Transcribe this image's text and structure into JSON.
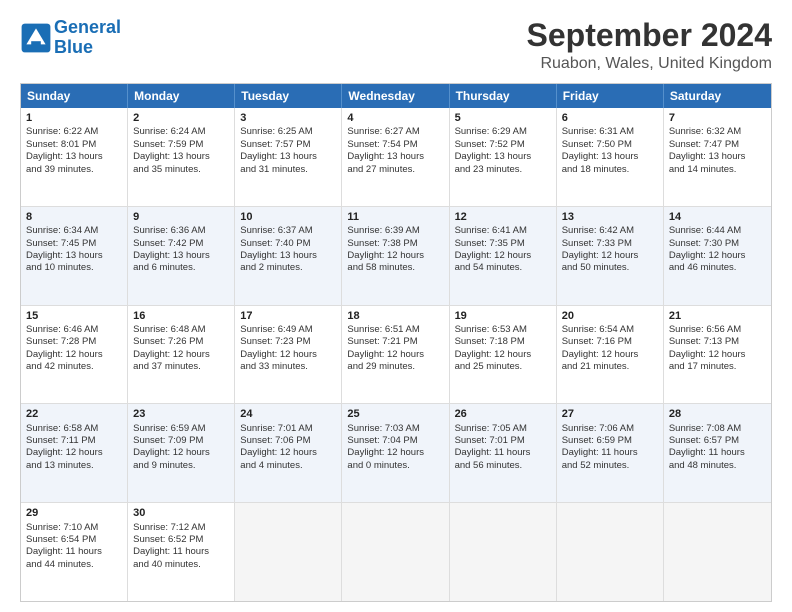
{
  "header": {
    "logo_line1": "General",
    "logo_line2": "Blue",
    "main_title": "September 2024",
    "subtitle": "Ruabon, Wales, United Kingdom"
  },
  "calendar": {
    "days_of_week": [
      "Sunday",
      "Monday",
      "Tuesday",
      "Wednesday",
      "Thursday",
      "Friday",
      "Saturday"
    ],
    "rows": [
      [
        {
          "day": "1",
          "lines": [
            "Sunrise: 6:22 AM",
            "Sunset: 8:01 PM",
            "Daylight: 13 hours",
            "and 39 minutes."
          ]
        },
        {
          "day": "2",
          "lines": [
            "Sunrise: 6:24 AM",
            "Sunset: 7:59 PM",
            "Daylight: 13 hours",
            "and 35 minutes."
          ]
        },
        {
          "day": "3",
          "lines": [
            "Sunrise: 6:25 AM",
            "Sunset: 7:57 PM",
            "Daylight: 13 hours",
            "and 31 minutes."
          ]
        },
        {
          "day": "4",
          "lines": [
            "Sunrise: 6:27 AM",
            "Sunset: 7:54 PM",
            "Daylight: 13 hours",
            "and 27 minutes."
          ]
        },
        {
          "day": "5",
          "lines": [
            "Sunrise: 6:29 AM",
            "Sunset: 7:52 PM",
            "Daylight: 13 hours",
            "and 23 minutes."
          ]
        },
        {
          "day": "6",
          "lines": [
            "Sunrise: 6:31 AM",
            "Sunset: 7:50 PM",
            "Daylight: 13 hours",
            "and 18 minutes."
          ]
        },
        {
          "day": "7",
          "lines": [
            "Sunrise: 6:32 AM",
            "Sunset: 7:47 PM",
            "Daylight: 13 hours",
            "and 14 minutes."
          ]
        }
      ],
      [
        {
          "day": "8",
          "lines": [
            "Sunrise: 6:34 AM",
            "Sunset: 7:45 PM",
            "Daylight: 13 hours",
            "and 10 minutes."
          ]
        },
        {
          "day": "9",
          "lines": [
            "Sunrise: 6:36 AM",
            "Sunset: 7:42 PM",
            "Daylight: 13 hours",
            "and 6 minutes."
          ]
        },
        {
          "day": "10",
          "lines": [
            "Sunrise: 6:37 AM",
            "Sunset: 7:40 PM",
            "Daylight: 13 hours",
            "and 2 minutes."
          ]
        },
        {
          "day": "11",
          "lines": [
            "Sunrise: 6:39 AM",
            "Sunset: 7:38 PM",
            "Daylight: 12 hours",
            "and 58 minutes."
          ]
        },
        {
          "day": "12",
          "lines": [
            "Sunrise: 6:41 AM",
            "Sunset: 7:35 PM",
            "Daylight: 12 hours",
            "and 54 minutes."
          ]
        },
        {
          "day": "13",
          "lines": [
            "Sunrise: 6:42 AM",
            "Sunset: 7:33 PM",
            "Daylight: 12 hours",
            "and 50 minutes."
          ]
        },
        {
          "day": "14",
          "lines": [
            "Sunrise: 6:44 AM",
            "Sunset: 7:30 PM",
            "Daylight: 12 hours",
            "and 46 minutes."
          ]
        }
      ],
      [
        {
          "day": "15",
          "lines": [
            "Sunrise: 6:46 AM",
            "Sunset: 7:28 PM",
            "Daylight: 12 hours",
            "and 42 minutes."
          ]
        },
        {
          "day": "16",
          "lines": [
            "Sunrise: 6:48 AM",
            "Sunset: 7:26 PM",
            "Daylight: 12 hours",
            "and 37 minutes."
          ]
        },
        {
          "day": "17",
          "lines": [
            "Sunrise: 6:49 AM",
            "Sunset: 7:23 PM",
            "Daylight: 12 hours",
            "and 33 minutes."
          ]
        },
        {
          "day": "18",
          "lines": [
            "Sunrise: 6:51 AM",
            "Sunset: 7:21 PM",
            "Daylight: 12 hours",
            "and 29 minutes."
          ]
        },
        {
          "day": "19",
          "lines": [
            "Sunrise: 6:53 AM",
            "Sunset: 7:18 PM",
            "Daylight: 12 hours",
            "and 25 minutes."
          ]
        },
        {
          "day": "20",
          "lines": [
            "Sunrise: 6:54 AM",
            "Sunset: 7:16 PM",
            "Daylight: 12 hours",
            "and 21 minutes."
          ]
        },
        {
          "day": "21",
          "lines": [
            "Sunrise: 6:56 AM",
            "Sunset: 7:13 PM",
            "Daylight: 12 hours",
            "and 17 minutes."
          ]
        }
      ],
      [
        {
          "day": "22",
          "lines": [
            "Sunrise: 6:58 AM",
            "Sunset: 7:11 PM",
            "Daylight: 12 hours",
            "and 13 minutes."
          ]
        },
        {
          "day": "23",
          "lines": [
            "Sunrise: 6:59 AM",
            "Sunset: 7:09 PM",
            "Daylight: 12 hours",
            "and 9 minutes."
          ]
        },
        {
          "day": "24",
          "lines": [
            "Sunrise: 7:01 AM",
            "Sunset: 7:06 PM",
            "Daylight: 12 hours",
            "and 4 minutes."
          ]
        },
        {
          "day": "25",
          "lines": [
            "Sunrise: 7:03 AM",
            "Sunset: 7:04 PM",
            "Daylight: 12 hours",
            "and 0 minutes."
          ]
        },
        {
          "day": "26",
          "lines": [
            "Sunrise: 7:05 AM",
            "Sunset: 7:01 PM",
            "Daylight: 11 hours",
            "and 56 minutes."
          ]
        },
        {
          "day": "27",
          "lines": [
            "Sunrise: 7:06 AM",
            "Sunset: 6:59 PM",
            "Daylight: 11 hours",
            "and 52 minutes."
          ]
        },
        {
          "day": "28",
          "lines": [
            "Sunrise: 7:08 AM",
            "Sunset: 6:57 PM",
            "Daylight: 11 hours",
            "and 48 minutes."
          ]
        }
      ],
      [
        {
          "day": "29",
          "lines": [
            "Sunrise: 7:10 AM",
            "Sunset: 6:54 PM",
            "Daylight: 11 hours",
            "and 44 minutes."
          ]
        },
        {
          "day": "30",
          "lines": [
            "Sunrise: 7:12 AM",
            "Sunset: 6:52 PM",
            "Daylight: 11 hours",
            "and 40 minutes."
          ]
        },
        {
          "day": "",
          "lines": [],
          "empty": true
        },
        {
          "day": "",
          "lines": [],
          "empty": true
        },
        {
          "day": "",
          "lines": [],
          "empty": true
        },
        {
          "day": "",
          "lines": [],
          "empty": true
        },
        {
          "day": "",
          "lines": [],
          "empty": true
        }
      ]
    ]
  }
}
